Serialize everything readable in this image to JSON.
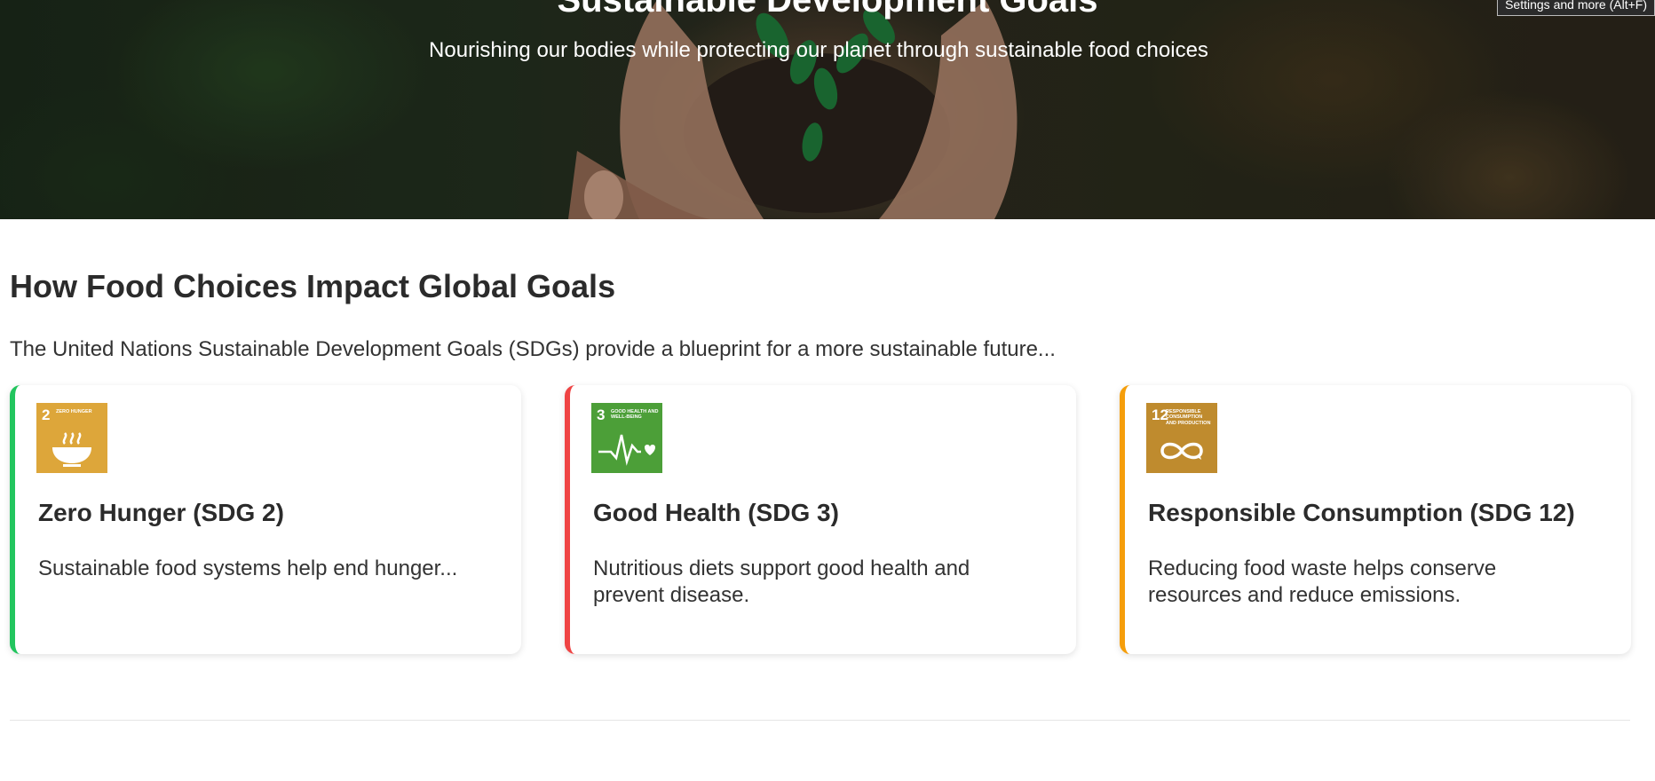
{
  "hero": {
    "title": "Sustainable Development Goals",
    "subtitle": "Nourishing our bodies while protecting our planet through sustainable food choices"
  },
  "tooltip": {
    "text": "Settings and more (Alt+F)"
  },
  "section": {
    "title": "How Food Choices Impact Global Goals",
    "intro": "The United Nations Sustainable Development Goals (SDGs) provide a blueprint for a more sustainable future..."
  },
  "cards": [
    {
      "badge_number": "2",
      "badge_label": "ZERO HUNGER",
      "badge_color": "#DDA63A",
      "icon": "bowl-icon",
      "accent": "#22c55e",
      "title": "Zero Hunger (SDG 2)",
      "text": "Sustainable food systems help end hunger..."
    },
    {
      "badge_number": "3",
      "badge_label": "GOOD HEALTH AND WELL-BEING",
      "badge_color": "#4C9F38",
      "icon": "heartbeat-icon",
      "accent": "#ef4444",
      "title": "Good Health (SDG 3)",
      "text": "Nutritious diets support good health and prevent disease."
    },
    {
      "badge_number": "12",
      "badge_label": "RESPONSIBLE CONSUMPTION AND PRODUCTION",
      "badge_color": "#BF8B2E",
      "icon": "infinity-icon",
      "accent": "#f59e0b",
      "title": "Responsible Consumption (SDG 12)",
      "text": "Reducing food waste helps conserve resources and reduce emissions."
    }
  ]
}
